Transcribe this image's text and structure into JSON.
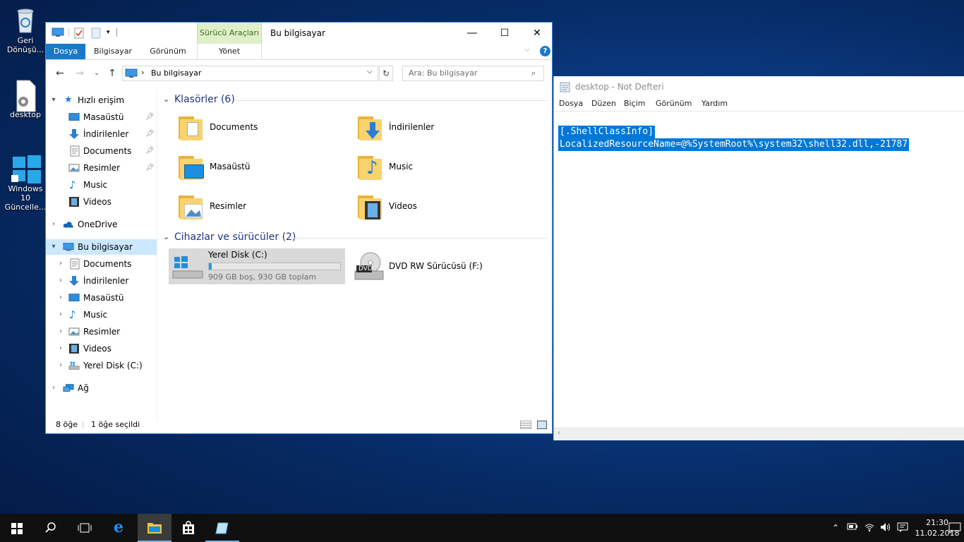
{
  "desktop": {
    "icons": [
      {
        "label": "Geri Dönüşü..."
      },
      {
        "label": "desktop"
      },
      {
        "label": "Windows 10 Güncelle..."
      }
    ]
  },
  "explorer": {
    "title": "Bu bilgisayar",
    "tool_tab_header": "Sürücü Araçları",
    "ribbon_tabs": [
      "Dosya",
      "Bilgisayar",
      "Görünüm",
      "Yönet"
    ],
    "address_path": "Bu bilgisayar",
    "search_placeholder": "Ara: Bu bilgisayar",
    "nav": {
      "quick_access": "Hızlı erişim",
      "quick_items": [
        "Masaüstü",
        "İndirilenler",
        "Documents",
        "Resimler",
        "Music",
        "Videos"
      ],
      "onedrive": "OneDrive",
      "this_pc": "Bu bilgisayar",
      "pc_items": [
        "Documents",
        "İndirilenler",
        "Masaüstü",
        "Music",
        "Resimler",
        "Videos",
        "Yerel Disk (C:)"
      ],
      "network": "Ağ"
    },
    "folders_header": "Klasörler (6)",
    "folders": [
      "Documents",
      "İndirilenler",
      "Masaüstü",
      "Music",
      "Resimler",
      "Videos"
    ],
    "devices_header": "Cihazlar ve sürücüler (2)",
    "drives": [
      {
        "name": "Yerel Disk (C:)",
        "detail": "909 GB boş, 930 GB toplam",
        "used_fraction": 0.023
      },
      {
        "name": "DVD RW Sürücüsü (F:)",
        "badge": "DVD"
      }
    ],
    "status": {
      "count": "8 öğe",
      "selected": "1 öğe seçildi"
    }
  },
  "notepad": {
    "title": "desktop - Not Defteri",
    "menu": [
      "Dosya",
      "Düzen",
      "Biçim",
      "Görünüm",
      "Yardım"
    ],
    "lines": [
      "[.ShellClassInfo]",
      "LocalizedResourceName=@%SystemRoot%\\system32\\shell32.dll,-21787"
    ]
  },
  "taskbar": {
    "clock_time": "21:30",
    "clock_date": "11.02.2018"
  },
  "colors": {
    "accent": "#1979ca",
    "selection": "#0078d7",
    "nav_selected": "#cce8ff",
    "tool_tab": "#dff0c8"
  }
}
